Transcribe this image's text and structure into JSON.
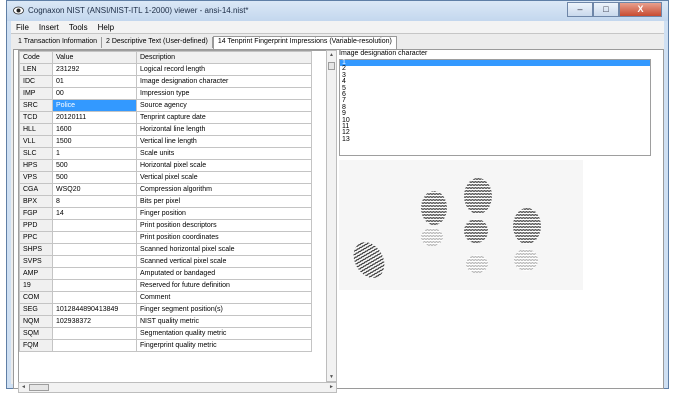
{
  "window": {
    "title": "Cognaxon NIST (ANSI/NIST-ITL 1-2000) viewer - ansi-14.nist*",
    "minimize_label": "–",
    "maximize_label": "□",
    "close_label": "X"
  },
  "menu": {
    "items": [
      {
        "label": "File",
        "name": "menu-file"
      },
      {
        "label": "Insert",
        "name": "menu-insert"
      },
      {
        "label": "Tools",
        "name": "menu-tools"
      },
      {
        "label": "Help",
        "name": "menu-help"
      }
    ]
  },
  "tabs": [
    {
      "label": "1 Transaction Information",
      "active": false
    },
    {
      "label": "2 Descriptive Text (User-defined)",
      "active": false
    },
    {
      "label": "14 Tenprint Fingerprint Impressions (Variable-resolution)",
      "active": true
    }
  ],
  "table": {
    "columns": [
      "Code",
      "Value",
      "Description"
    ],
    "selected_row_index": 3,
    "rows": [
      {
        "code": "LEN",
        "value": "231292",
        "description": "Logical record length"
      },
      {
        "code": "IDC",
        "value": "01",
        "description": "Image designation character"
      },
      {
        "code": "IMP",
        "value": "00",
        "description": "Impression type"
      },
      {
        "code": "SRC",
        "value": "Police",
        "description": "Source agency"
      },
      {
        "code": "TCD",
        "value": "20120111",
        "description": "Tenprint capture date"
      },
      {
        "code": "HLL",
        "value": "1600",
        "description": "Horizontal line length"
      },
      {
        "code": "VLL",
        "value": "1500",
        "description": "Vertical line length"
      },
      {
        "code": "SLC",
        "value": "1",
        "description": "Scale units"
      },
      {
        "code": "HPS",
        "value": "500",
        "description": "Horizontal pixel scale"
      },
      {
        "code": "VPS",
        "value": "500",
        "description": "Vertical pixel scale"
      },
      {
        "code": "CGA",
        "value": "WSQ20",
        "description": "Compression algorithm"
      },
      {
        "code": "BPX",
        "value": "8",
        "description": "Bits per pixel"
      },
      {
        "code": "FGP",
        "value": "14",
        "description": "Finger position"
      },
      {
        "code": "PPD",
        "value": "",
        "description": "Print position descriptors"
      },
      {
        "code": "PPC",
        "value": "",
        "description": "Print position coordinates"
      },
      {
        "code": "SHPS",
        "value": "",
        "description": "Scanned horizontal pixel scale"
      },
      {
        "code": "SVPS",
        "value": "",
        "description": "Scanned vertical pixel scale"
      },
      {
        "code": "AMP",
        "value": "",
        "description": "Amputated or bandaged"
      },
      {
        "code": "19",
        "value": "",
        "description": "Reserved for future definition"
      },
      {
        "code": "COM",
        "value": "",
        "description": "Comment"
      },
      {
        "code": "SEG",
        "value": "1012844890413849",
        "description": "Finger segment position(s)"
      },
      {
        "code": "NQM",
        "value": "102938372",
        "description": "NIST quality metric"
      },
      {
        "code": "SQM",
        "value": "",
        "description": "Segmentation quality metric"
      },
      {
        "code": "FQM",
        "value": "",
        "description": "Fingerprint quality metric"
      }
    ]
  },
  "image_designation": {
    "label": "Image designation character",
    "selected_index": 0,
    "options": [
      "1",
      "2",
      "3",
      "4",
      "5",
      "6",
      "7",
      "8",
      "9",
      "10",
      "11",
      "12",
      "13"
    ]
  },
  "scroll": {
    "up_arrow": "▲",
    "down_arrow": "▼",
    "left_arrow": "◄",
    "right_arrow": "►"
  },
  "colors": {
    "selection": "#3399ff",
    "title_bar": "#c3d7ee",
    "close_button": "#c74a30"
  }
}
